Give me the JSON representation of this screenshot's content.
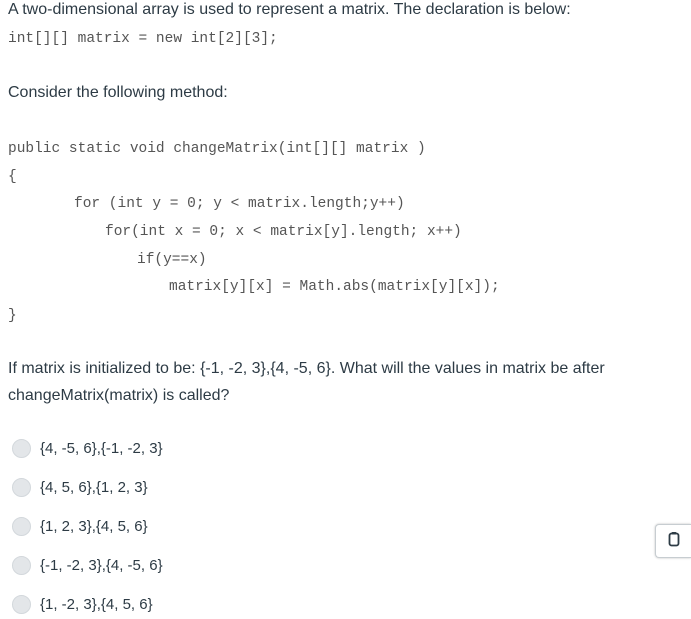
{
  "question": {
    "intro": "A two-dimensional array is used to represent a matrix. The declaration is below:",
    "declaration": "int[][] matrix = new int[2][3];",
    "consider": "Consider the following method:",
    "code": [
      "public static void changeMatrix(int[][] matrix )",
      "{",
      "for (int y = 0; y < matrix.length;y++)",
      "for(int x = 0; x < matrix[y].length; x++)",
      "if(y==x)",
      "matrix[y][x] = Math.abs(matrix[y][x]);",
      "}"
    ],
    "prompt": "If matrix is initialized to be: {-1, -2, 3},{4, -5, 6}. What will the values in matrix be after changeMatrix(matrix) is called?"
  },
  "options": [
    {
      "label": "{4, -5, 6},{-1, -2, 3}"
    },
    {
      "label": "{4, 5, 6},{1, 2, 3}"
    },
    {
      "label": "{1, 2, 3},{4, 5, 6}"
    },
    {
      "label": "{-1, -2, 3},{4, -5, 6}"
    },
    {
      "label": "{1, -2, 3},{4, 5, 6}"
    }
  ],
  "side_tab": {
    "icon": "clipboard-icon"
  },
  "colors": {
    "text": "#2d3b45",
    "code": "#555555",
    "radio": "#e3e6e9"
  }
}
